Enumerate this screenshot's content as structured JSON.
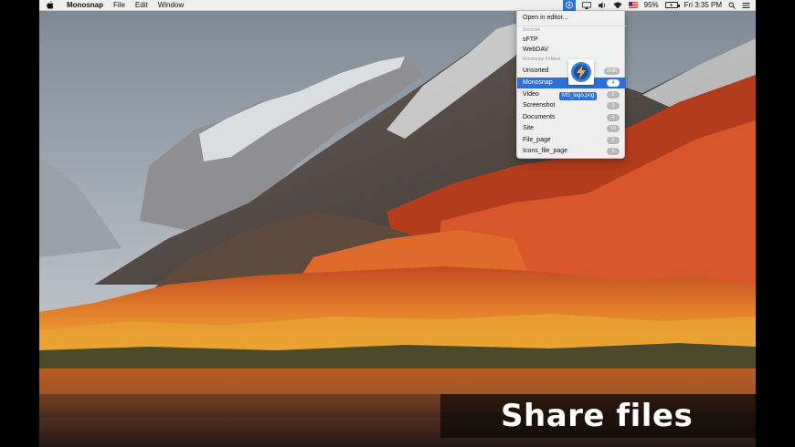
{
  "menubar": {
    "app_name": "Monosnap",
    "menus": [
      "File",
      "Edit",
      "Window"
    ],
    "battery_percent": "95%",
    "clock": "Fri 3:35 PM"
  },
  "dropdown": {
    "open_in_editor": "Open in editor...",
    "services_header": "Services",
    "services": [
      "sFTP",
      "WebDAV"
    ],
    "folders_header": "Monosnap Folders",
    "folders": [
      {
        "label": "Unsorted",
        "count": "3145"
      },
      {
        "label": "Monosnap",
        "count": "4",
        "selected": true
      },
      {
        "label": "Video",
        "count": "2"
      },
      {
        "label": "Screenshot",
        "count": "3"
      },
      {
        "label": "Documents",
        "count": "4"
      },
      {
        "label": "Site",
        "count": "10"
      },
      {
        "label": "File_page",
        "count": "0"
      },
      {
        "label": "Icons_file_page",
        "count": "5"
      }
    ]
  },
  "drag": {
    "file_name": "MS_logo.png"
  },
  "caption": "Share files",
  "colors": {
    "accent": "#2f6fd6",
    "menubar_bg": "#efefef"
  }
}
